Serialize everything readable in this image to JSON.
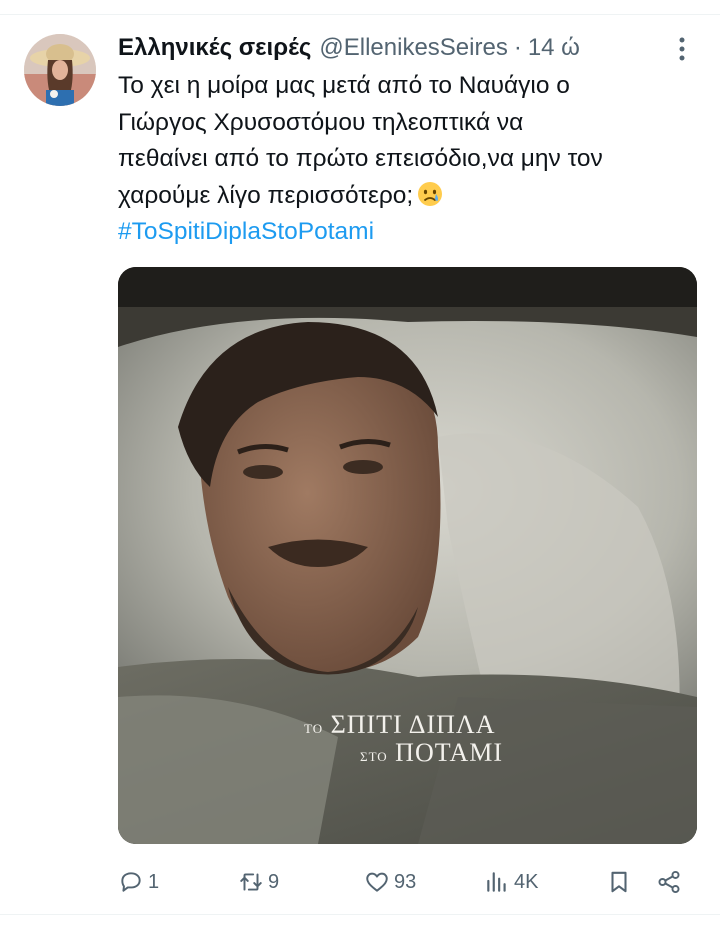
{
  "tweet": {
    "author": {
      "display_name": "Ελληνικές σειρές",
      "handle": "@EllenikesSeires",
      "separator": "·",
      "time": "14 ώ"
    },
    "text_lines": [
      "Το χει η μοίρα μας μετά από το Ναυάγιο ο",
      "Γιώργος Χρυσοστόμου τηλεοπτικά να",
      "πεθαίνει από το πρώτο επεισόδιο,να μην τον",
      "χαρούμε λίγο περισσότερο;"
    ],
    "emoji": "crying-face-emoji",
    "hashtag": "#ToSpitiDiplaStoPotami",
    "media": {
      "logo_text": {
        "line1_small": "ΤΟ",
        "line1_large": "ΣΠΙΤΙ ΔΙΠΛΑ",
        "line2_small": "ΣΤΟ",
        "line2_large": "ΠΟΤΑΜΙ"
      }
    },
    "stats": {
      "replies": "1",
      "retweets": "9",
      "likes": "93",
      "views": "4K"
    }
  },
  "icons": [
    "more-icon",
    "reply-icon",
    "retweet-icon",
    "like-icon",
    "views-icon",
    "bookmark-icon",
    "share-icon"
  ],
  "colors": {
    "text": "#0f1419",
    "secondary": "#536471",
    "link": "#1d9bf0",
    "divider": "#eff3f4"
  }
}
